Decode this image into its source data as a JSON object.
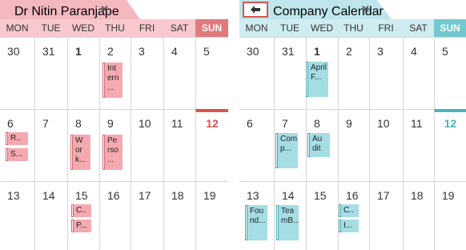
{
  "left": {
    "tab_title": "Dr Nitin Paranjape",
    "close_glyph": "✕",
    "accent": "#f4b8bf",
    "header_bg": "#f7c9ce",
    "sun_bg": "#e07a7c",
    "event_fill": "#f5a9b0",
    "event_border": "#d16a72",
    "today_color": "#d9534f",
    "days": [
      "MON",
      "TUE",
      "WED",
      "THU",
      "FRI",
      "SAT",
      "SUN"
    ],
    "weeks": [
      [
        "30",
        "31",
        "1",
        "2",
        "3",
        "4",
        "5"
      ],
      [
        "6",
        "7",
        "8",
        "9",
        "10",
        "11",
        "12"
      ],
      [
        "13",
        "14",
        "15",
        "16",
        "17",
        "18",
        "19"
      ]
    ],
    "events": {
      "w0d3": [
        "Int",
        "ern",
        "..."
      ],
      "w1d0a": [
        "R.."
      ],
      "w1d0b": [
        "S..."
      ],
      "w1d2": [
        "W",
        "or",
        "k..."
      ],
      "w1d3": [
        "Pe",
        "rso",
        "..."
      ],
      "w2d2a": [
        "C.."
      ],
      "w2d2b": [
        "P..."
      ]
    }
  },
  "right": {
    "tab_title": "Company Calendar",
    "close_glyph": "✕",
    "back_icon": "arrow-left-icon",
    "accent": "#bfe6ec",
    "header_bg": "#cfecf1",
    "sun_bg": "#72c8cf",
    "event_fill": "#a4dde4",
    "event_border": "#4aaab5",
    "today_color": "#4ab3bd",
    "days": [
      "MON",
      "TUE",
      "WED",
      "THU",
      "FRI",
      "SAT",
      "SUN"
    ],
    "weeks": [
      [
        "30",
        "31",
        "1",
        "2",
        "3",
        "4",
        "5"
      ],
      [
        "6",
        "7",
        "8",
        "9",
        "10",
        "11",
        "12"
      ],
      [
        "13",
        "14",
        "15",
        "16",
        "17",
        "18",
        "19"
      ]
    ],
    "events": {
      "w0d2": [
        "April",
        "F..."
      ],
      "w1d1": [
        "Com",
        "p..."
      ],
      "w1d2": [
        "Au",
        "dit"
      ],
      "w2d0": [
        "Fou",
        "nd..."
      ],
      "w2d1": [
        "Tea",
        "mB..."
      ],
      "w2d3a": [
        "C.."
      ],
      "w2d3b": [
        "I..."
      ]
    }
  }
}
